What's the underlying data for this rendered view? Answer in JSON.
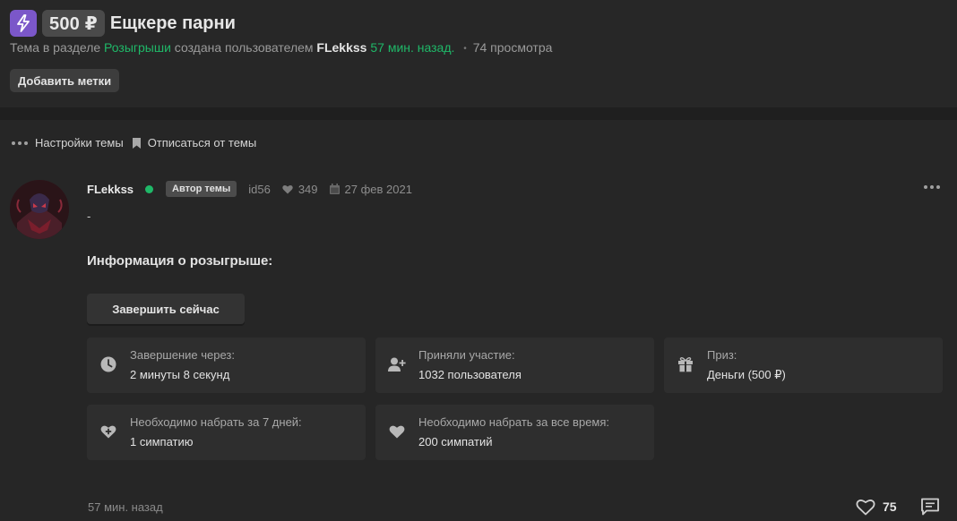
{
  "thread": {
    "price": "500 ₽",
    "title": "Ещкере парни",
    "meta_prefix": "Тема в разделе",
    "section": "Розыгрыши",
    "meta_created": "создана пользователем",
    "author": "FLekkss",
    "time_ago": "57 мин. назад.",
    "dot": "•",
    "views": "74 просмотра",
    "add_tags": "Добавить метки"
  },
  "tools": {
    "settings": "Настройки темы",
    "unsubscribe": "Отписаться от темы"
  },
  "post": {
    "author": "FLekkss",
    "badge": "Автор темы",
    "user_id": "id56",
    "likes": "349",
    "date": "27 фев 2021",
    "body": "-",
    "info_heading": "Информация о розыгрыше:",
    "finish_button": "Завершить сейчас",
    "cards": [
      {
        "title": "Завершение через:",
        "value": "2 минуты 8 секунд",
        "icon": "clock-icon"
      },
      {
        "title": "Приняли участие:",
        "value": "1032 пользователя",
        "icon": "user-plus-icon"
      },
      {
        "title": "Приз:",
        "value": "Деньги (500 ₽)",
        "icon": "gift-icon"
      },
      {
        "title": "Необходимо набрать за 7 дней:",
        "value": "1 симпатию",
        "icon": "heart-plus-icon"
      },
      {
        "title": "Необходимо набрать за все время:",
        "value": "200 симпатий",
        "icon": "heart-icon"
      }
    ],
    "time": "57 мин. назад",
    "like_count": "75"
  },
  "colors": {
    "accent_green": "#1fb868",
    "badge_purple": "#7b57c9",
    "background": "#262626"
  }
}
